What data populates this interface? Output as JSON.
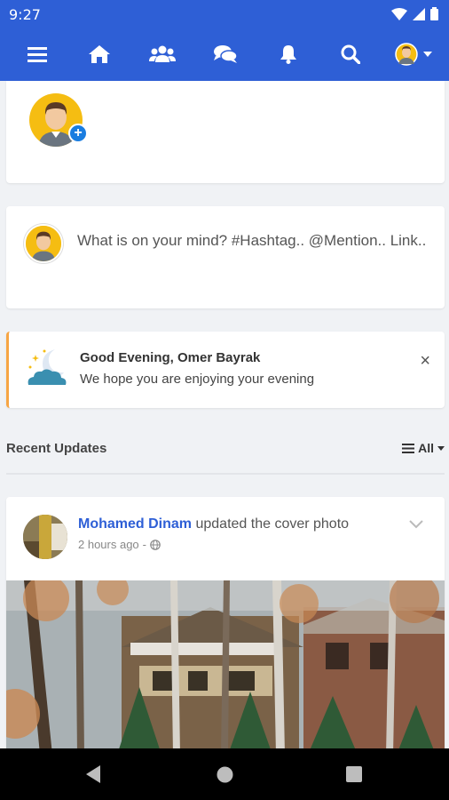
{
  "status_bar": {
    "time": "9:27"
  },
  "nav": {
    "items": [
      {
        "icon": "menu-icon"
      },
      {
        "icon": "home-icon"
      },
      {
        "icon": "friends-icon"
      },
      {
        "icon": "messages-icon"
      },
      {
        "icon": "notifications-icon"
      },
      {
        "icon": "search-icon"
      },
      {
        "icon": "profile-avatar"
      }
    ],
    "colors": {
      "bar": "#2e5fd6"
    }
  },
  "composer": {
    "placeholder": "What is on your mind? #Hashtag.. @Mention.. Link.."
  },
  "greeting": {
    "title": "Good Evening, Omer Bayrak",
    "subtitle": "We hope you are enjoying your evening",
    "close": "×",
    "accent": "#f7a543"
  },
  "recent": {
    "title": "Recent Updates",
    "filter_label": "All"
  },
  "post": {
    "author": "Mohamed Dinam",
    "action": "updated the cover photo",
    "time": "2 hours ago",
    "separator": "-"
  },
  "colors": {
    "brand": "#2e5fd6",
    "background": "#f0f2f5",
    "avatar_yellow": "#f5bd12"
  }
}
